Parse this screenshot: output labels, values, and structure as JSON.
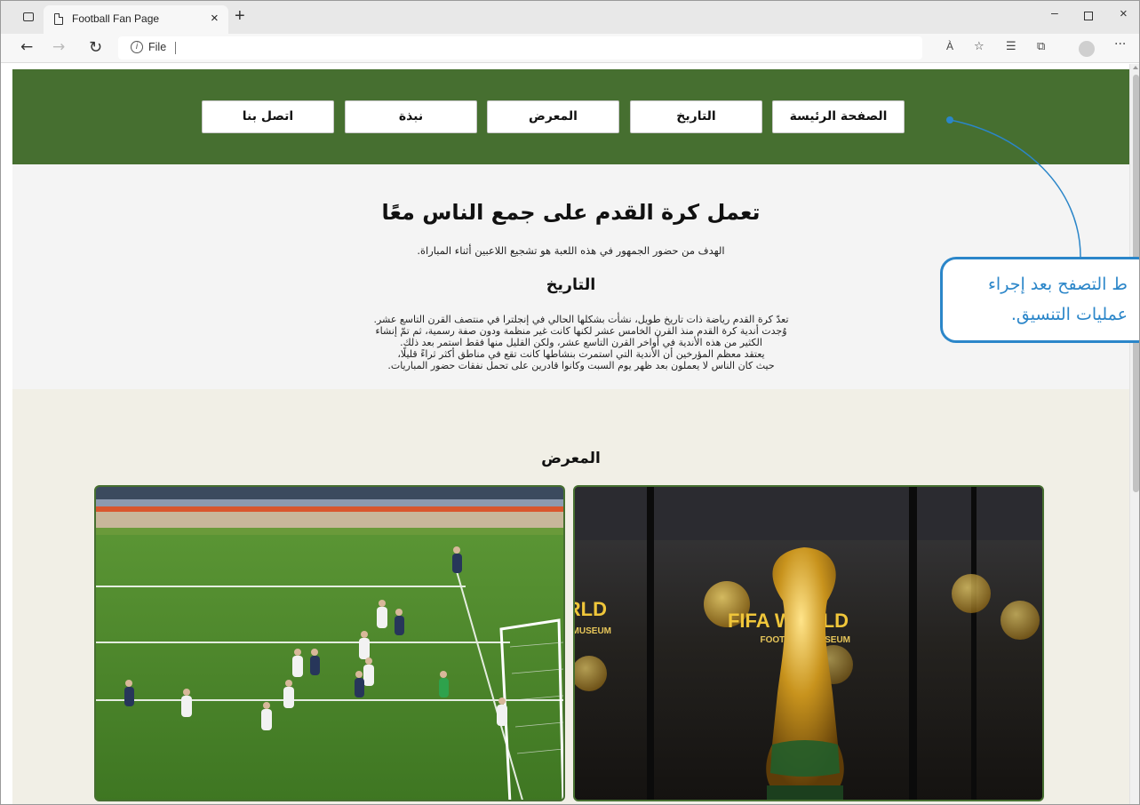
{
  "browser": {
    "tab_title": "Football Fan Page",
    "tab_close": "×",
    "new_tab": "+",
    "address_label": "File",
    "reader_label": "À",
    "window_min": "–",
    "window_close": "×",
    "more": "···"
  },
  "nav": {
    "home": "الصفحة الرئيسة",
    "history": "التاريخ",
    "gallery": "المعرض",
    "about": "نبذة",
    "contact": "اتصل بنا"
  },
  "intro": {
    "title": "تعمل كرة القدم على جمع الناس معًا",
    "subtitle": "الهدف من حضور الجمهور في هذه اللعبة هو تشجيع اللاعبين أثناء المباراة."
  },
  "history": {
    "title": "التاريخ",
    "lines": [
      "تعدّ كرة القدم رياضة ذات تاريخ طويل، نشأت بشكلها الحالي في إنجلترا في منتصف القرن التاسع عشر.",
      "وُجدت أندية كرة القدم منذ القرن الخامس عشر لكنها كانت غير منظمة ودون صفة رسمية، ثم تمّ إنشاء",
      "الكثير من هذه الأندية في أواخر القرن التاسع عشر، ولكن القليل منها فقط استمر بعد ذلك.",
      "يعتقد معظم المؤرخين أن الأندية التي استمرت بنشاطها كانت تقع في مناطق أكثر ثراءً قليلًا،",
      "حيث كان الناس لا يعملون بعد ظهر يوم السبت وكانوا قادرين على تحمل نفقات حضور المباريات."
    ]
  },
  "gallery": {
    "title": "المعرض",
    "trophy_sign_1": "FIFA WORLD",
    "trophy_sign_2": "FOOTBALL MUSEUM"
  },
  "callout": {
    "line1": "ط التصفح بعد إجراء",
    "line2": "عمليات التنسيق."
  },
  "colors": {
    "header_green": "#466f30",
    "callout_blue": "#2b86c9",
    "gallery_bg": "#f1efe6"
  }
}
